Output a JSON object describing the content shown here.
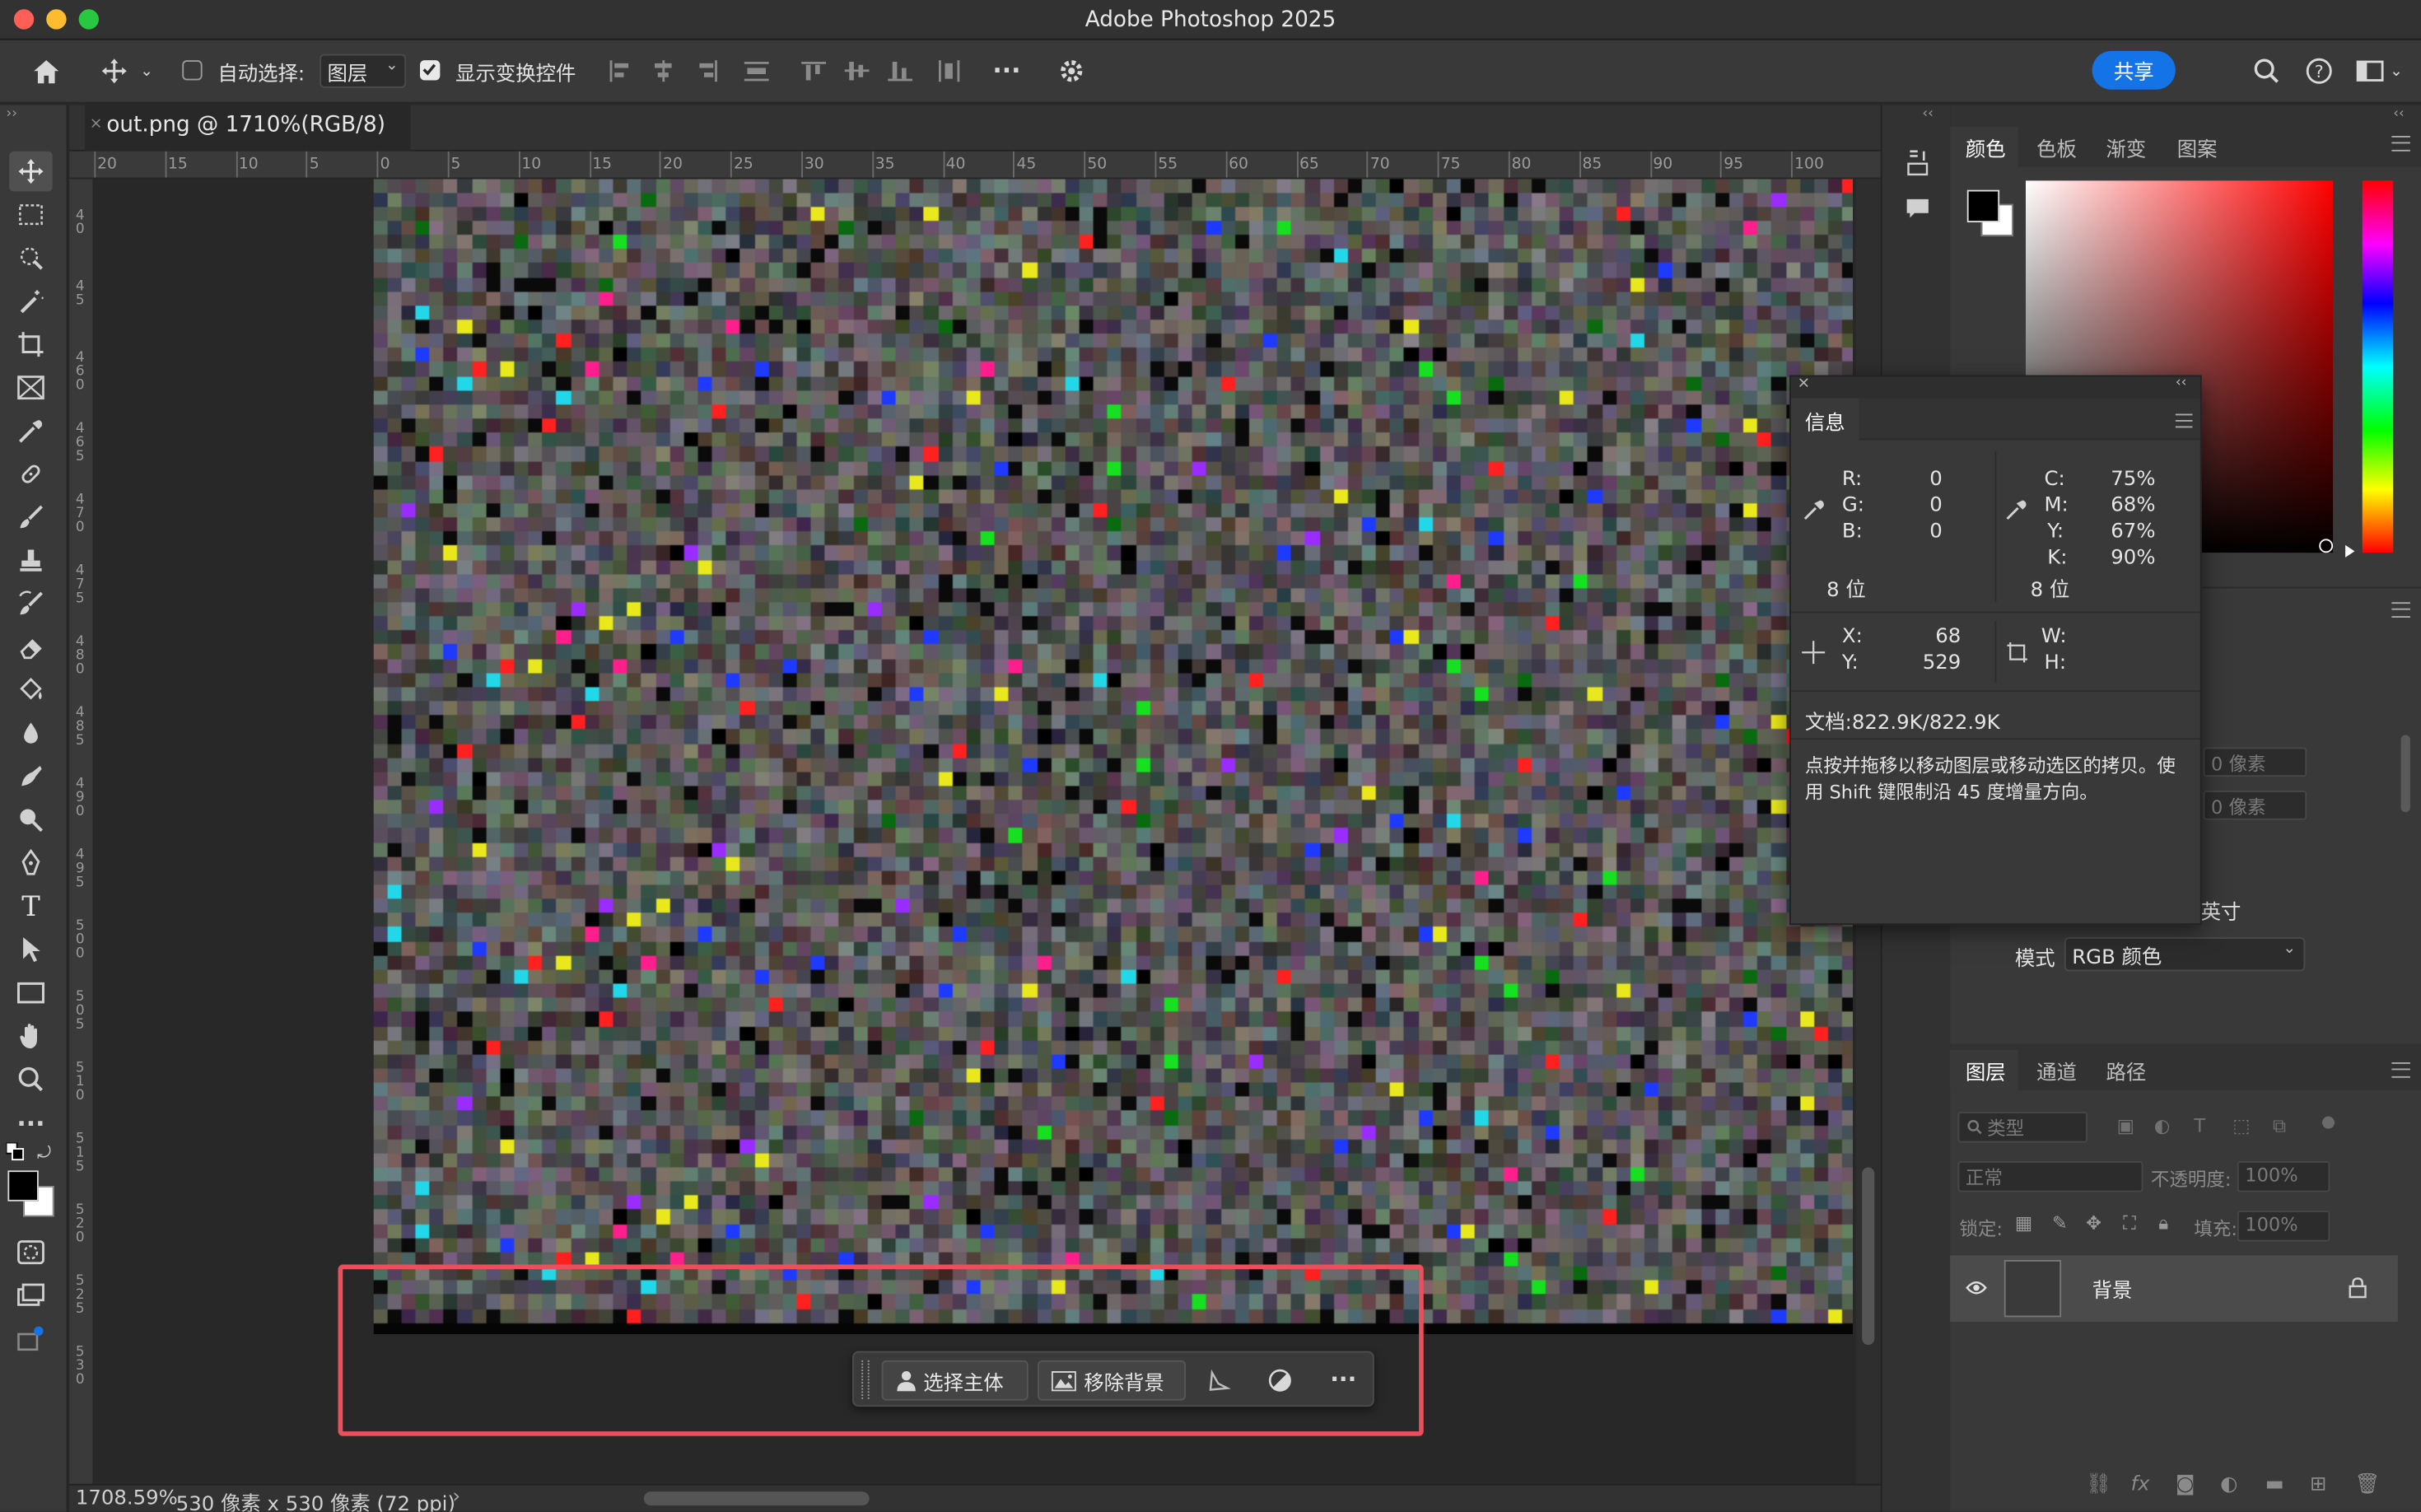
{
  "window": {
    "title": "Adobe Photoshop 2025"
  },
  "options_bar": {
    "auto_select_label": "自动选择:",
    "auto_select_checked": false,
    "auto_select_target": "图层",
    "show_transform_label": "显示变换控件",
    "show_transform_checked": true,
    "share_label": "共享"
  },
  "document": {
    "tab_title": "out.png @ 1710%(RGB/8)"
  },
  "rulers": {
    "top_ticks": [
      "20",
      "15",
      "10",
      "5",
      "0",
      "5",
      "10",
      "15",
      "20",
      "25",
      "30",
      "35",
      "40",
      "45",
      "50",
      "55",
      "60",
      "65",
      "70",
      "75",
      "80",
      "85",
      "90",
      "95",
      "100"
    ],
    "left_ticks": [
      "40",
      "45",
      "460",
      "465",
      "470",
      "475",
      "480",
      "485",
      "490",
      "495",
      "500",
      "505",
      "510",
      "515",
      "520",
      "525",
      "530"
    ]
  },
  "status": {
    "zoom": "1708.59%",
    "doc_size": "530 像素 x 530 像素 (72 ppi)",
    "arrow": "›"
  },
  "contextual_taskbar": {
    "select_subject": "选择主体",
    "remove_background": "移除背景",
    "more": "···"
  },
  "colors": {
    "accent": "#1473e6",
    "highlight_border": "#e8515b",
    "foreground": "#000000",
    "background": "#ffffff"
  },
  "color_panel": {
    "tabs": [
      "颜色",
      "色板",
      "渐变",
      "图案"
    ]
  },
  "info_panel": {
    "title": "信息",
    "r_label": "R:",
    "r": "0",
    "g_label": "G:",
    "g": "0",
    "b_label": "B:",
    "b": "0",
    "bits_left": "8 位",
    "c_label": "C:",
    "c": "75%",
    "m_label": "M:",
    "m": "68%",
    "y_label": "Y:",
    "ycmyk": "67%",
    "k_label": "K:",
    "k": "90%",
    "bits_right": "8 位",
    "x_label": "X:",
    "x": "68",
    "ypos_label": "Y:",
    "ypos": "529",
    "w_label": "W:",
    "h_label": "H:",
    "doc_size": "文档:822.9K/822.9K",
    "hint": "点按并拖移以移动图层或移动选区的拷贝。使用 Shift 键限制沿 45 度增量方向。"
  },
  "properties_partial": {
    "px_placeholder_1": "0 像素",
    "px_placeholder_2": "0 像素",
    "unit_fragment": "/英寸",
    "mode_label": "模式",
    "mode_value": "RGB 颜色"
  },
  "layers_panel": {
    "tabs": [
      "图层",
      "通道",
      "路径"
    ],
    "filter_placeholder": "类型",
    "blend_mode": "正常",
    "opacity_label": "不透明度:",
    "opacity_value": "100%",
    "lock_label": "锁定:",
    "fill_label": "填充:",
    "fill_value": "100%",
    "layers": [
      {
        "name": "背景",
        "visible": true,
        "locked": true
      }
    ],
    "footer_fx": "fx"
  }
}
